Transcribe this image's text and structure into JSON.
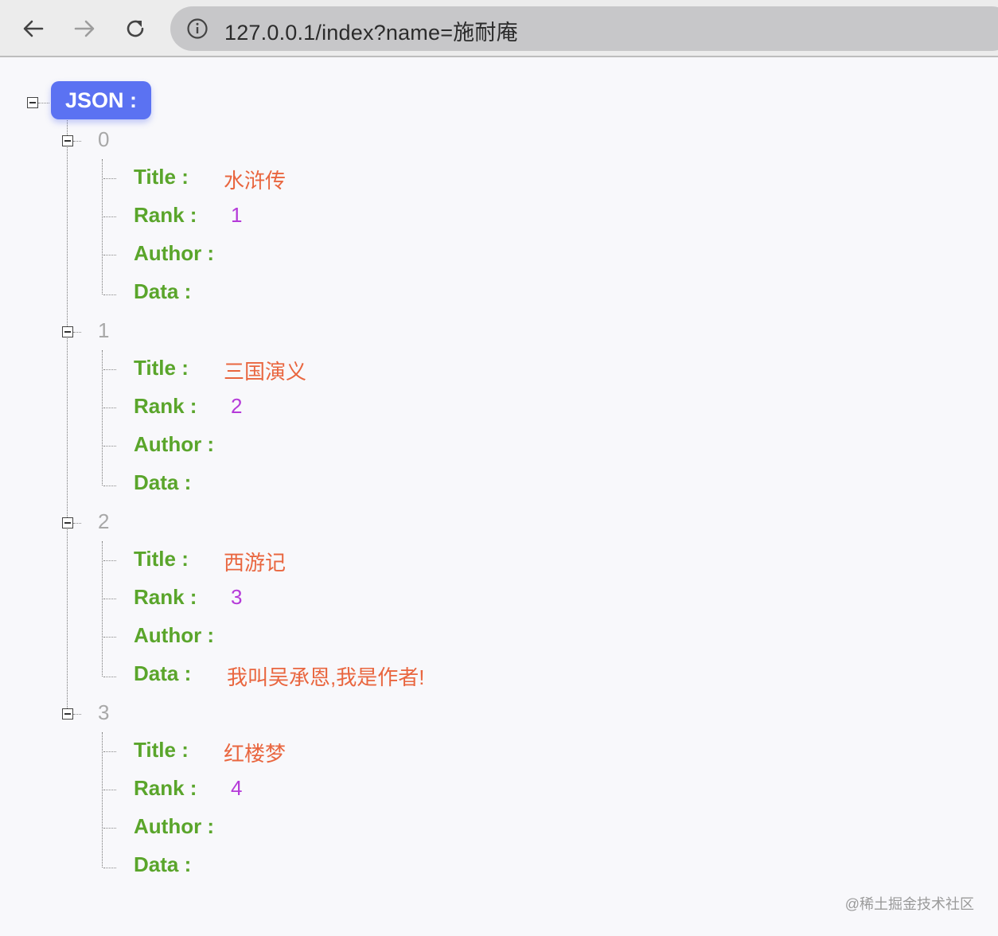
{
  "browser": {
    "url": "127.0.0.1/index?name=施耐庵",
    "back_icon": "arrow-left-icon",
    "forward_icon": "arrow-right-icon",
    "reload_icon": "reload-icon",
    "info_icon": "info-icon"
  },
  "colors": {
    "badge": "#5b72f2",
    "key": "#5aa52b",
    "string_value": "#e9663f",
    "number_value": "#b53ad9",
    "index": "#a8a8a8"
  },
  "tree": {
    "root_label": "JSON :",
    "key_labels": {
      "title": "Title :",
      "rank": "Rank :",
      "author": "Author :",
      "data": "Data :"
    },
    "items": [
      {
        "index": "0",
        "title": "水浒传",
        "rank": "1",
        "author": "",
        "data": ""
      },
      {
        "index": "1",
        "title": "三国演义",
        "rank": "2",
        "author": "",
        "data": ""
      },
      {
        "index": "2",
        "title": "西游记",
        "rank": "3",
        "author": "",
        "data": "我叫吴承恩,我是作者!"
      },
      {
        "index": "3",
        "title": "红楼梦",
        "rank": "4",
        "author": "",
        "data": ""
      }
    ]
  },
  "watermark": "@稀土掘金技术社区"
}
